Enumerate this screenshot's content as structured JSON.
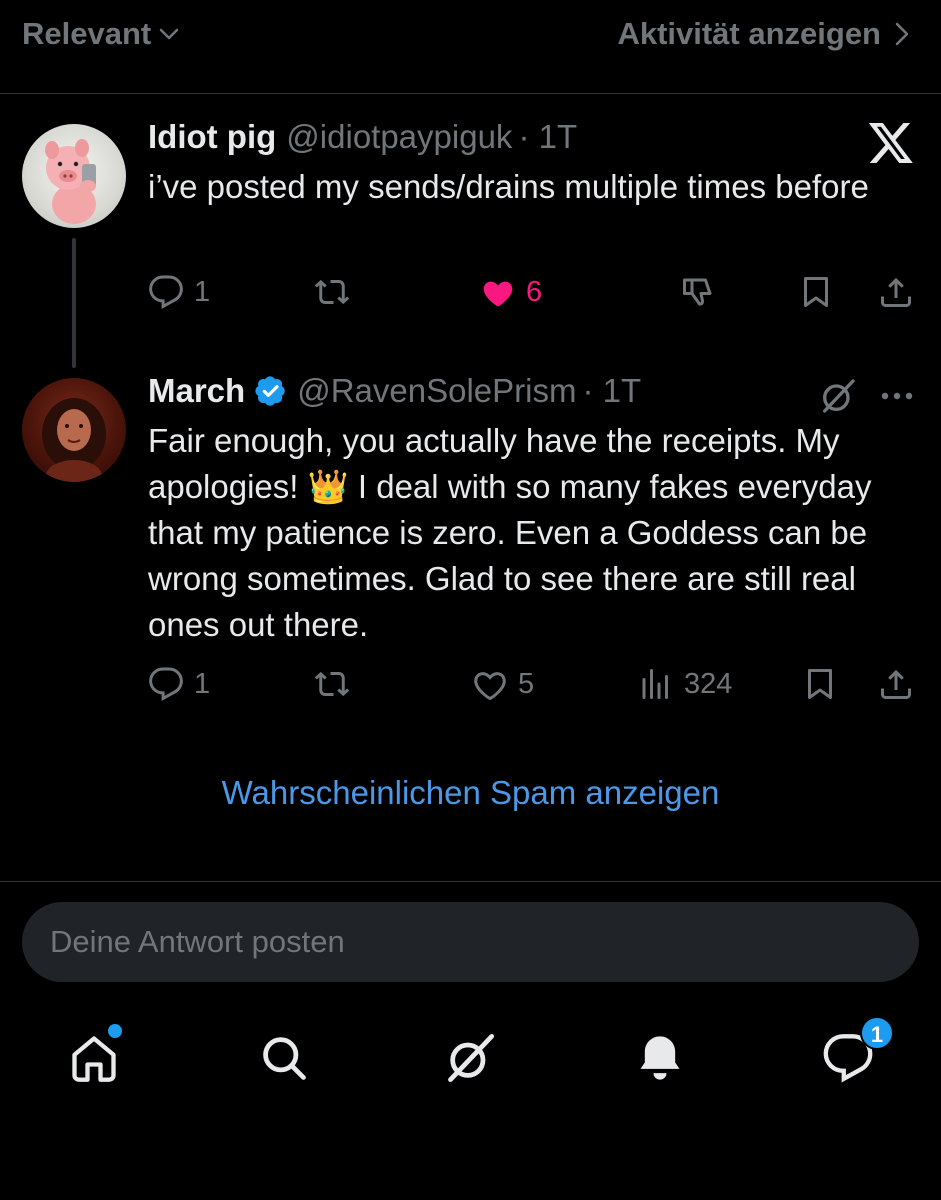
{
  "topbar": {
    "sort_label": "Relevant",
    "activity_label": "Aktivität anzeigen"
  },
  "tweet1": {
    "name": "Idiot pig",
    "handle": "@idiotpaypiguk",
    "time": "· 1T",
    "text": "i’ve posted my sends/drains multiple times before",
    "replies": "1",
    "likes": "6",
    "liked": true
  },
  "tweet2": {
    "name": "March",
    "handle": "@RavenSolePrism",
    "time": "· 1T",
    "verified": true,
    "text_part1": "Fair enough, you actually have the receipts. My apologies! ",
    "crown": "👑",
    "text_part2": " I deal with so many fakes everyday that my patience is zero. Even a Goddess can be wrong sometimes. Glad to see there are still real ones out there.",
    "replies": "1",
    "likes": "5",
    "views": "324"
  },
  "spam_link": "Wahrscheinlichen Spam anzeigen",
  "reply": {
    "placeholder": "Deine Antwort posten"
  },
  "tabs": {
    "messages_badge": "1"
  },
  "colors": {
    "like": "#f91880",
    "link": "#4a99e9",
    "accent": "#1d9bf0",
    "muted": "#71767b"
  }
}
